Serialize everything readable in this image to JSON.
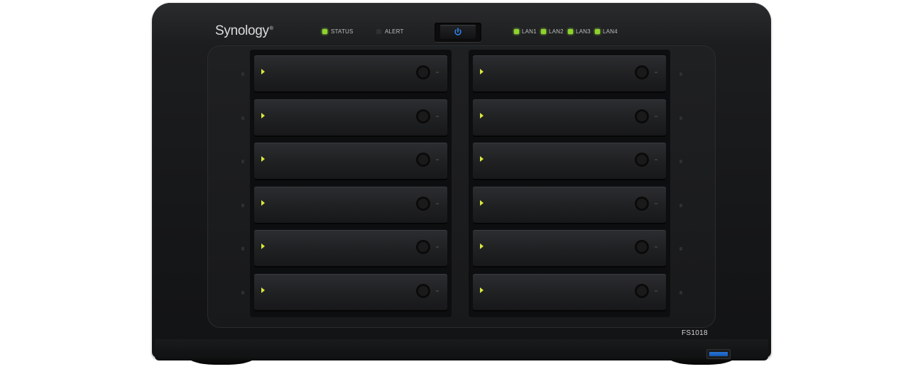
{
  "brand": "Synology",
  "brand_mark": "®",
  "indicators": [
    {
      "label": "STATUS",
      "state": "on"
    },
    {
      "label": "ALERT",
      "state": "off"
    },
    {
      "label": "LAN1",
      "state": "on"
    },
    {
      "label": "LAN2",
      "state": "on"
    },
    {
      "label": "LAN3",
      "state": "on"
    },
    {
      "label": "LAN4",
      "state": "on"
    }
  ],
  "power_icon": "power-icon",
  "model": "FS1018",
  "drive_bays": 12,
  "colors": {
    "led_green": "#8cd42a",
    "tray_arrow": "#d9e83a",
    "power_blue": "#2f8cff",
    "usb_blue": "#1e6ac8"
  }
}
